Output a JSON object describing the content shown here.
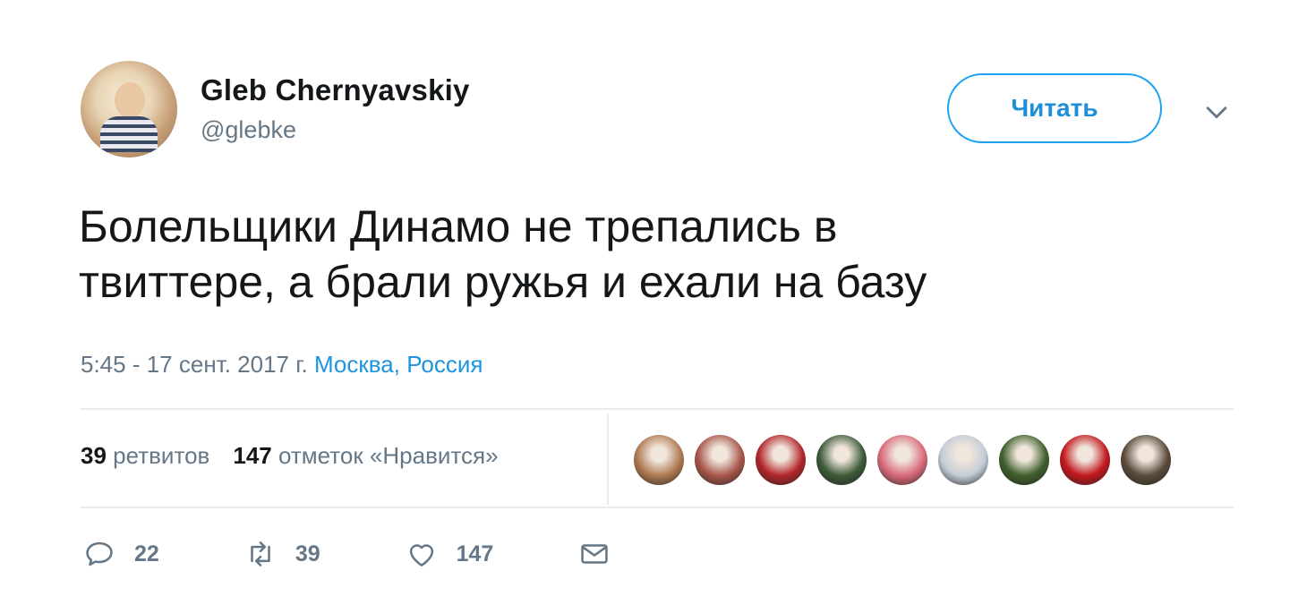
{
  "author": {
    "name": "Gleb Chernyavskiy",
    "handle": "@glebke"
  },
  "follow_button": "Читать",
  "tweet": {
    "lines": [
      "Болельщики Динамо не трепались в",
      "твиттере, а брали ружья и ехали на базу"
    ],
    "timestamp": "5:45 - 17 сент. 2017 г.",
    "location": "Москва, Россия"
  },
  "stats": {
    "retweets_count": "39",
    "retweets_label": "ретвитов",
    "likes_count": "147",
    "likes_label": "отметок «Нравится»"
  },
  "likers": [
    {
      "color": "#b07a52"
    },
    {
      "color": "#a8564a"
    },
    {
      "color": "#b3262a"
    },
    {
      "color": "#3d5a38"
    },
    {
      "color": "#d96a7a"
    },
    {
      "color": "#c3ccd6"
    },
    {
      "color": "#3f5f2c"
    },
    {
      "color": "#c2181f"
    },
    {
      "color": "#5a4a3a"
    }
  ],
  "actions": {
    "reply_count": "22",
    "retweet_count": "39",
    "like_count": "147"
  },
  "colors": {
    "accent": "#1da1f2",
    "link": "#1b95e0",
    "muted": "#657786",
    "text": "#14171a"
  }
}
